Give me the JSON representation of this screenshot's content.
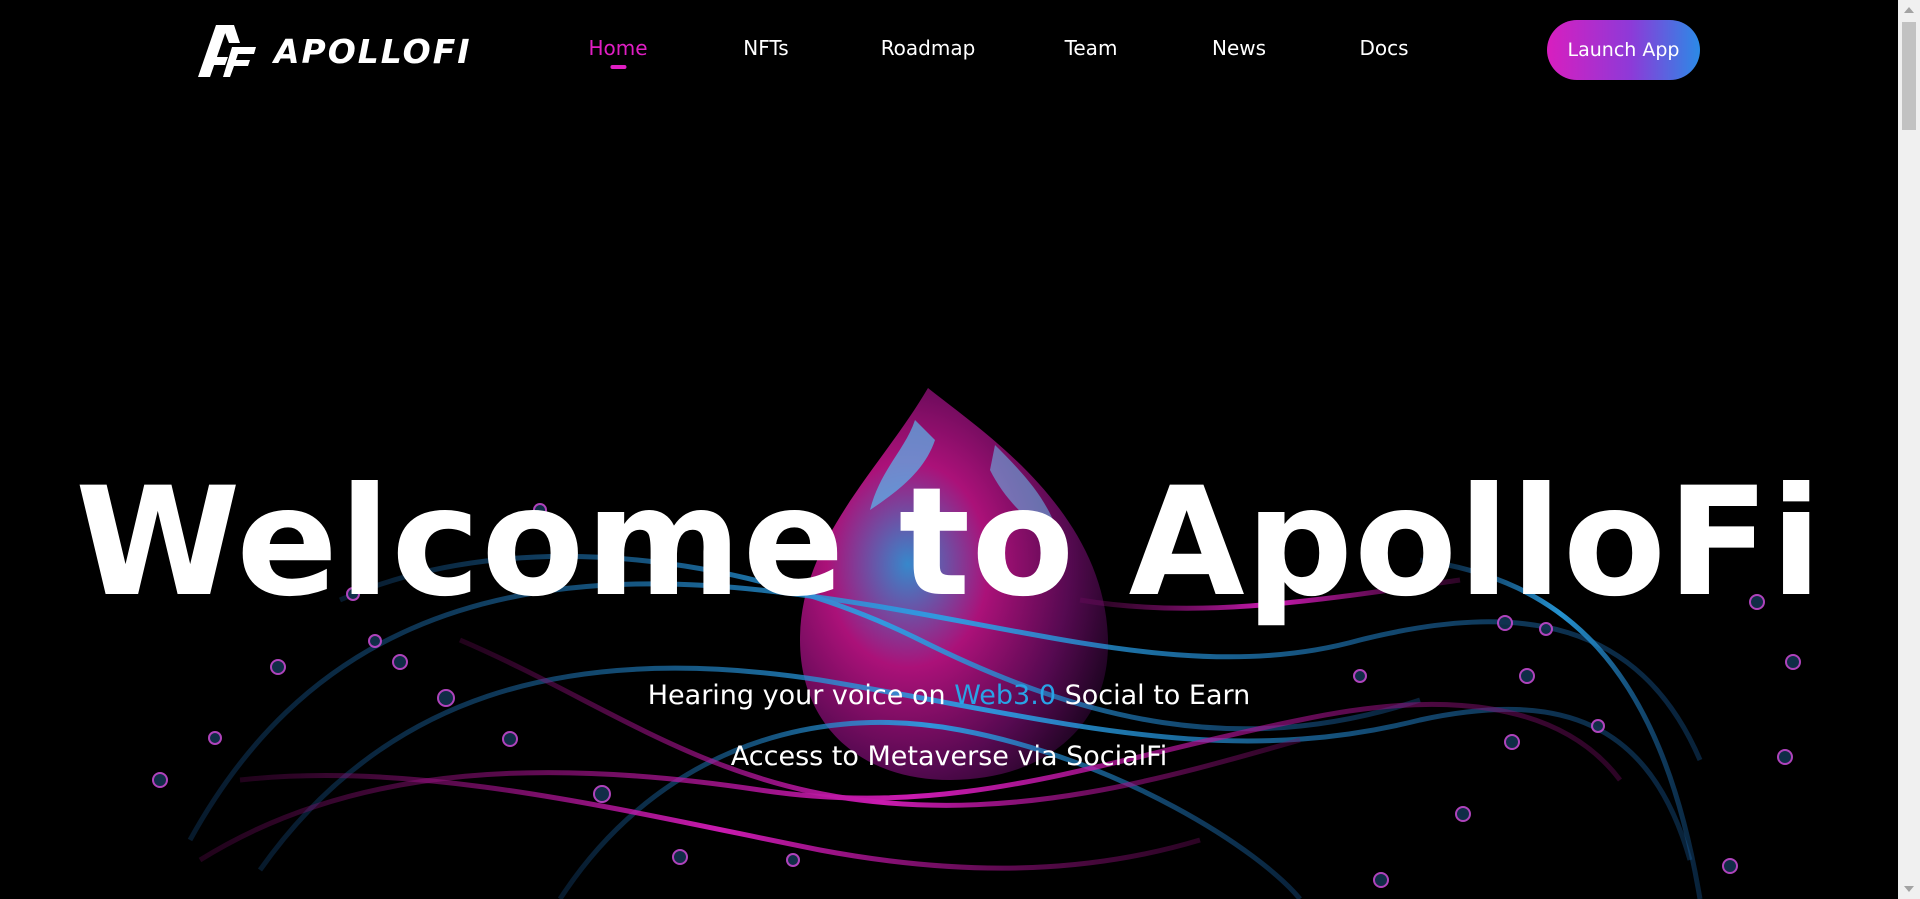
{
  "brand": {
    "name": "APOLLOFI"
  },
  "nav": {
    "items": [
      {
        "label": "Home",
        "active": true
      },
      {
        "label": "NFTs",
        "active": false
      },
      {
        "label": "Roadmap",
        "active": false
      },
      {
        "label": "Team",
        "active": false
      },
      {
        "label": "News",
        "active": false
      },
      {
        "label": "Docs",
        "active": false
      }
    ],
    "launch_label": "Launch App"
  },
  "hero": {
    "title": "Welcome to ApolloFi",
    "line1_before": "Hearing your voice on ",
    "line1_accent": "Web3.0",
    "line1_after": " Social to Earn",
    "line2": "Access to Metaverse via SocialFi"
  },
  "colors": {
    "background": "#000000",
    "accent_pink": "#e01ec3",
    "accent_blue": "#29a3e6"
  },
  "icons": {
    "logo": "apollofi-logo-icon"
  }
}
